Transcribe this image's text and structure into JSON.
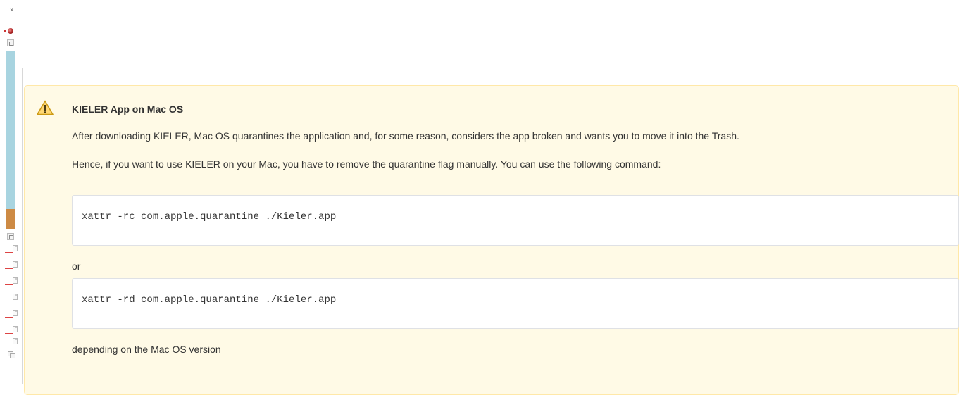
{
  "sidebar": {
    "close_glyph": "×",
    "accent_colors": {
      "blue": "#a8d4e0",
      "orange": "#cd8a44",
      "red": "#d44"
    }
  },
  "warning": {
    "icon": "warning-triangle-icon",
    "title": "KIELER App on Mac OS",
    "paragraph1": "After downloading KIELER, Mac OS quarantines the application and, for some reason, considers the app broken and wants you to move it into the Trash.",
    "paragraph2": "Hence, if you want to use KIELER on your Mac, you have to remove the quarantine flag manually. You can use the following command:",
    "command1": "xattr -rc com.apple.quarantine ./Kieler.app",
    "or_text": "or",
    "command2": "xattr -rd com.apple.quarantine ./Kieler.app",
    "footer_text": "depending on the Mac OS version",
    "colors": {
      "background": "#fffae6",
      "border": "#ffe8a8"
    }
  }
}
